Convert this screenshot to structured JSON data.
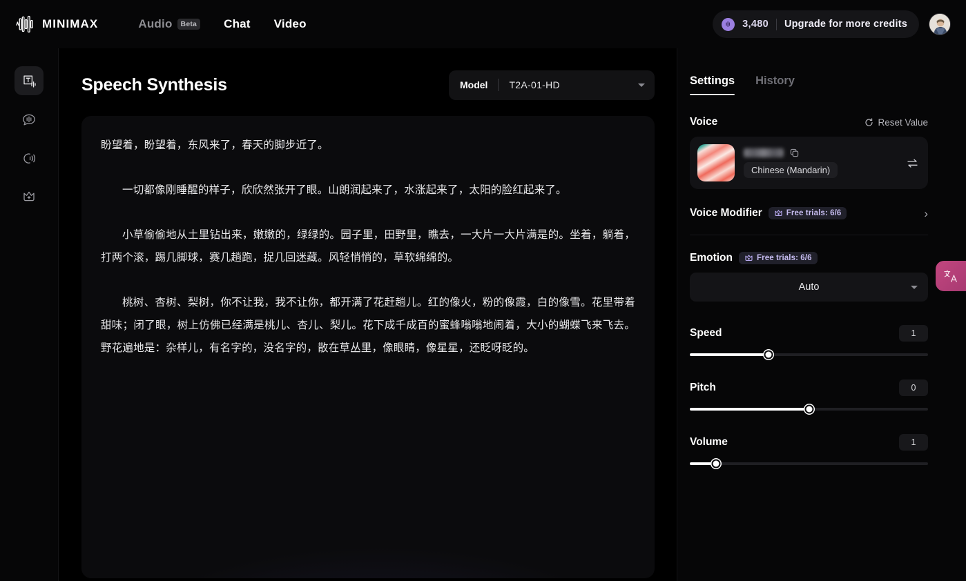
{
  "topbar": {
    "brand_name": "MINIMAX",
    "brand_icon": "waveform-logo-icon",
    "nav": [
      {
        "label": "Audio",
        "badge": "Beta",
        "active": false,
        "dim": true
      },
      {
        "label": "Chat",
        "badge": null,
        "active": false,
        "dim": false
      },
      {
        "label": "Video",
        "badge": null,
        "active": false,
        "dim": false
      }
    ],
    "credits": {
      "icon": "audio-credit-icon",
      "amount": "3,480",
      "upgrade_label": "Upgrade for more credits",
      "icon_color": "#9b7fe0"
    },
    "avatar_name": "user-avatar"
  },
  "rail": {
    "items": [
      {
        "icon": "speech-synthesis-icon",
        "active": true
      },
      {
        "icon": "voice-chat-icon",
        "active": false
      },
      {
        "icon": "voice-broadcast-icon",
        "active": false
      },
      {
        "icon": "crown-premium-icon",
        "active": false
      }
    ]
  },
  "main": {
    "page_title": "Speech Synthesis",
    "model": {
      "label": "Model",
      "value": "T2A-01-HD"
    },
    "editor_paragraphs": [
      "盼望着，盼望着，东风来了，春天的脚步近了。",
      "一切都像刚睡醒的样子，欣欣然张开了眼。山朗润起来了，水涨起来了，太阳的脸红起来了。",
      "小草偷偷地从土里钻出来，嫩嫩的，绿绿的。园子里，田野里，瞧去，一大片一大片满是的。坐着，躺着，打两个滚，踢几脚球，赛几趟跑，捉几回迷藏。风轻悄悄的，草软绵绵的。",
      "桃树、杏树、梨树，你不让我，我不让你，都开满了花赶趟儿。红的像火，粉的像霞，白的像雪。花里带着甜味；闭了眼，树上仿佛已经满是桃儿、杏儿、梨儿。花下成千成百的蜜蜂嗡嗡地闹着，大小的蝴蝶飞来飞去。野花遍地是：杂样儿，有名字的，没名字的，散在草丛里，像眼睛，像星星，还眨呀眨的。"
    ]
  },
  "panel": {
    "tabs": [
      {
        "label": "Settings",
        "active": true
      },
      {
        "label": "History",
        "active": false
      }
    ],
    "voice": {
      "section_label": "Voice",
      "reset_label": "Reset Value",
      "reset_icon": "reset-circle-icon",
      "name_redacted": true,
      "copy_icon": "copy-icon",
      "language_chip": "Chinese (Mandarin)",
      "swap_icon": "swap-arrows-icon"
    },
    "voice_modifier": {
      "label": "Voice Modifier",
      "badge_icon": "crown-icon",
      "badge_text": "Free trials: 6/6",
      "chevron": "›"
    },
    "emotion": {
      "label": "Emotion",
      "badge_icon": "crown-icon",
      "badge_text": "Free trials: 6/6",
      "selected": "Auto"
    },
    "sliders": [
      {
        "name": "Speed",
        "value": "1",
        "percent": 33
      },
      {
        "name": "Pitch",
        "value": "0",
        "percent": 50
      },
      {
        "name": "Volume",
        "value": "1",
        "percent": 11
      }
    ],
    "accent_color": "#c6bcf0"
  },
  "fab": {
    "icon": "translate-icon",
    "color": "#c2467f"
  }
}
